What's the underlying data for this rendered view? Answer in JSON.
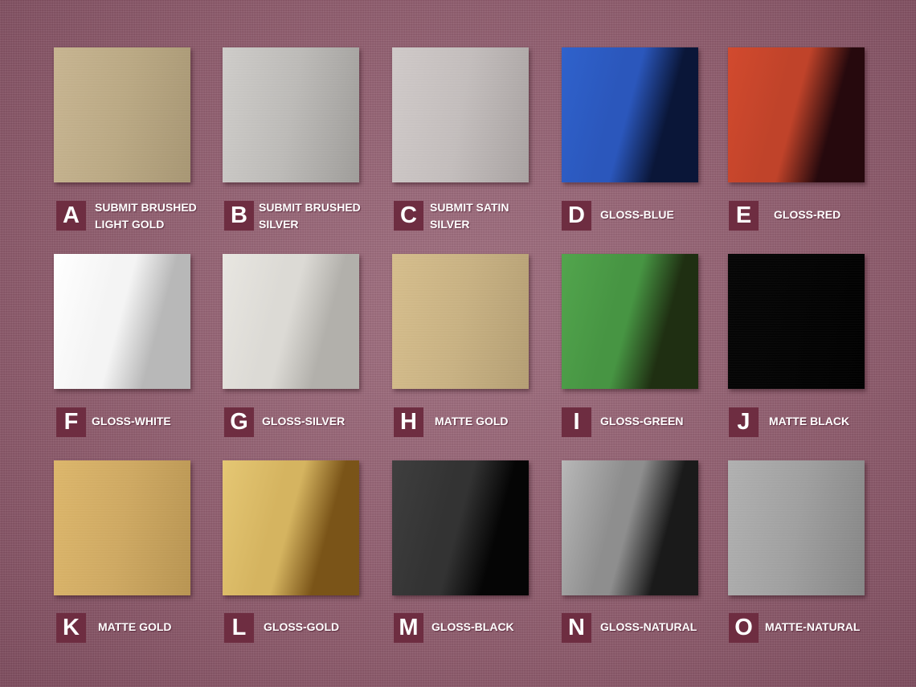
{
  "swatches": [
    {
      "letter": "A",
      "label_lines": [
        "SUBMIT BRUSHED",
        "LIGHT GOLD"
      ],
      "colors": [
        "#c8b591",
        "#bba984",
        "#a89774"
      ],
      "finish": "brushed-light-gold"
    },
    {
      "letter": "B",
      "label_lines": [
        "SUBMIT BRUSHED",
        "SILVER"
      ],
      "colors": [
        "#cfcdca",
        "#bdbbb8",
        "#9f9d9a"
      ],
      "finish": "brushed-silver"
    },
    {
      "letter": "C",
      "label_lines": [
        "SUBMIT SATIN",
        "SILVER"
      ],
      "colors": [
        "#d0cac9",
        "#c4bebd",
        "#a9a3a2"
      ],
      "finish": "satin-silver"
    },
    {
      "letter": "D",
      "label_lines": [
        "GLOSS-BLUE"
      ],
      "colors": [
        "#2f62cc",
        "#2b57bc",
        "#0a1638"
      ],
      "finish": "gloss-blue"
    },
    {
      "letter": "E",
      "label_lines": [
        "GLOSS-RED"
      ],
      "colors": [
        "#d24a2e",
        "#c0432a",
        "#26090d"
      ],
      "finish": "gloss-red"
    },
    {
      "letter": "F",
      "label_lines": [
        "GLOSS-WHITE"
      ],
      "colors": [
        "#ffffff",
        "#f4f4f4",
        "#b8b8b8"
      ],
      "finish": "gloss-white"
    },
    {
      "letter": "G",
      "label_lines": [
        "GLOSS-SILVER"
      ],
      "colors": [
        "#e8e6e1",
        "#dcdad5",
        "#b2b0ab"
      ],
      "finish": "gloss-silver"
    },
    {
      "letter": "H",
      "label_lines": [
        "MATTE GOLD"
      ],
      "colors": [
        "#d6be8c",
        "#c9b283",
        "#b59f74"
      ],
      "finish": "matte-gold"
    },
    {
      "letter": "I",
      "label_lines": [
        "GLOSS-GREEN"
      ],
      "colors": [
        "#52a54d",
        "#479543",
        "#1f2f12"
      ],
      "finish": "gloss-green"
    },
    {
      "letter": "J",
      "label_lines": [
        "MATTE BLACK"
      ],
      "colors": [
        "#050505",
        "#030303",
        "#000000"
      ],
      "finish": "matte-black"
    },
    {
      "letter": "K",
      "label_lines": [
        "MATTE GOLD"
      ],
      "colors": [
        "#ddb76b",
        "#cfa962",
        "#b99552"
      ],
      "finish": "matte-gold"
    },
    {
      "letter": "L",
      "label_lines": [
        "GLOSS-GOLD"
      ],
      "colors": [
        "#e5c774",
        "#d5b460",
        "#7a5418"
      ],
      "finish": "gloss-gold"
    },
    {
      "letter": "M",
      "label_lines": [
        "GLOSS-BLACK"
      ],
      "colors": [
        "#3f3f3f",
        "#333333",
        "#050505"
      ],
      "finish": "gloss-black"
    },
    {
      "letter": "N",
      "label_lines": [
        "GLOSS-NATURAL"
      ],
      "colors": [
        "#b8b8b8",
        "#8e8e8e",
        "#1a1a1a"
      ],
      "finish": "gloss-natural"
    },
    {
      "letter": "O",
      "label_lines": [
        "MATTE-NATURAL"
      ],
      "colors": [
        "#b1b1b1",
        "#a0a0a0",
        "#868686"
      ],
      "finish": "matte-natural"
    }
  ],
  "colors": {
    "background": "#8f5a6d",
    "letter_box": "#6e2d41",
    "label_text": "#ffffff"
  }
}
